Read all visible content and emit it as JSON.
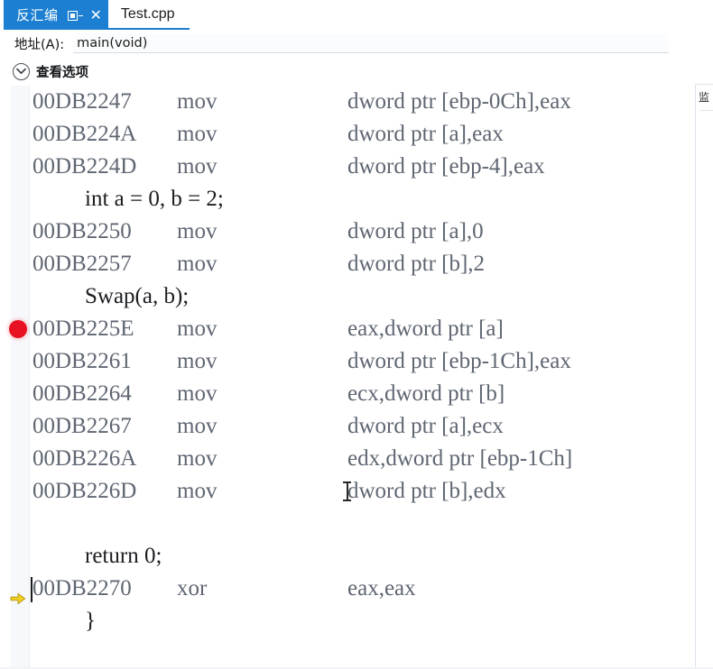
{
  "window": {
    "tabs": [
      {
        "label": "反汇编",
        "active": true,
        "icons": [
          "pin-icon",
          "close-icon"
        ]
      },
      {
        "label": "Test.cpp",
        "active": false,
        "icons": []
      }
    ]
  },
  "address_bar": {
    "label": "地址(A):",
    "value": "main(void)",
    "placeholder": ""
  },
  "view_options": {
    "label": "查看选项",
    "icon": "chevron-down-circle-icon",
    "expanded": true
  },
  "right_panel": {
    "tab_label": "监",
    "icon": "watch-window-icon"
  },
  "code": {
    "lines": [
      {
        "type": "asm",
        "address": "00DB2247",
        "mnemonic": "mov",
        "operands": "dword ptr [ebp-0Ch],eax",
        "marker": "none"
      },
      {
        "type": "asm",
        "address": "00DB224A",
        "mnemonic": "mov",
        "operands": "dword ptr [a],eax",
        "marker": "none"
      },
      {
        "type": "asm",
        "address": "00DB224D",
        "mnemonic": "mov",
        "operands": "dword ptr [ebp-4],eax",
        "marker": "none"
      },
      {
        "type": "src",
        "text": "int a = 0, b = 2;",
        "marker": "none"
      },
      {
        "type": "asm",
        "address": "00DB2250",
        "mnemonic": "mov",
        "operands": "dword ptr [a],0",
        "marker": "none"
      },
      {
        "type": "asm",
        "address": "00DB2257",
        "mnemonic": "mov",
        "operands": "dword ptr [b],2",
        "marker": "none"
      },
      {
        "type": "src",
        "text": "Swap(a, b);",
        "marker": "none"
      },
      {
        "type": "asm",
        "address": "00DB225E",
        "mnemonic": "mov",
        "operands": "eax,dword ptr [a]",
        "marker": "breakpoint"
      },
      {
        "type": "asm",
        "address": "00DB2261",
        "mnemonic": "mov",
        "operands": "dword ptr [ebp-1Ch],eax",
        "marker": "none"
      },
      {
        "type": "asm",
        "address": "00DB2264",
        "mnemonic": "mov",
        "operands": "ecx,dword ptr [b]",
        "marker": "none"
      },
      {
        "type": "asm",
        "address": "00DB2267",
        "mnemonic": "mov",
        "operands": "dword ptr [a],ecx",
        "marker": "none"
      },
      {
        "type": "asm",
        "address": "00DB226A",
        "mnemonic": "mov",
        "operands": "edx,dword ptr [ebp-1Ch]",
        "marker": "none"
      },
      {
        "type": "asm",
        "address": "00DB226D",
        "mnemonic": "mov",
        "operands": "dword ptr [b],edx",
        "marker": "none"
      },
      {
        "type": "blank",
        "text": "",
        "marker": "none"
      },
      {
        "type": "src",
        "text": "return 0;",
        "marker": "none"
      },
      {
        "type": "asm",
        "address": "00DB2270",
        "mnemonic": "xor",
        "operands": "eax,eax",
        "marker": "instruction-pointer",
        "caret": true
      },
      {
        "type": "src",
        "text": "}",
        "marker": "none"
      }
    ]
  },
  "colors": {
    "tab_active_bg": "#1c7fd1",
    "tab_active_text": "#ffffff",
    "tab_underline": "#1c7fd1",
    "breakpoint": "#e81123",
    "instruction_pointer": "#f2d024",
    "asm_text": "#5f6672",
    "source_text": "#1b1d21",
    "gutter_bg": "#f7f8fb"
  }
}
